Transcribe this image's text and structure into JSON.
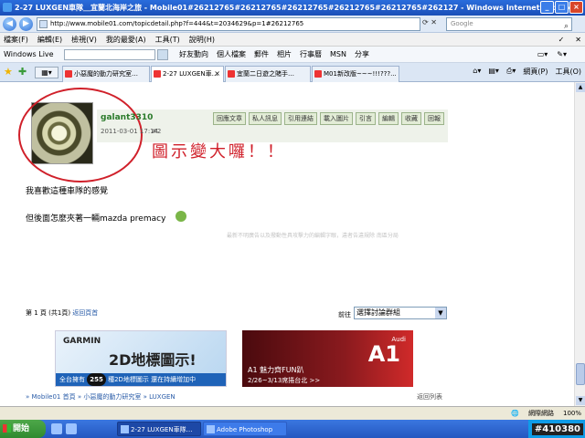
{
  "window": {
    "title": "2-27 LUXGEN車隊＿宜蘭北海岸之旅 - Mobile01#26212765#26212765#26212765#26212765#26212765#262127 - Windows Internet Explorer",
    "controls": [
      "_",
      "□",
      "×"
    ]
  },
  "address_bar": {
    "url": "http://www.mobile01.com/topicdetail.php?f=444&t=2034629&p=1#26212765",
    "search_placeholder": "Google"
  },
  "menu": {
    "items": [
      "檔案(F)",
      "編輯(E)",
      "檢視(V)",
      "我的最愛(A)",
      "工具(T)",
      "說明(H)"
    ],
    "right_items": [
      "✓",
      "✕"
    ]
  },
  "links_bar": {
    "windows_live": "Windows Live",
    "quick_links": [
      "好友動向",
      "個人檔案",
      "郵件",
      "相片",
      "行事曆",
      "MSN",
      "分享"
    ]
  },
  "tabs": [
    {
      "label": "小惡魔的動力研究室…"
    },
    {
      "label": "2-27 LUXGEN車…",
      "active": true
    },
    {
      "label": "宜蘭二日遊之賭手…"
    },
    {
      "label": "M01新改版~~~!!!???..."
    }
  ],
  "toolbar": {
    "page_label": "網頁(P)",
    "tools_label": "工具(O)"
  },
  "post": {
    "username": "galant3310",
    "date": "2011-03-01 17:14",
    "post_number": "#2",
    "actions": [
      "回應文章",
      "私人訊息",
      "引用連結",
      "載入圖片",
      "引言",
      "編輯",
      "收藏",
      "回報"
    ],
    "annotation": "圖示變大囉！！",
    "message_line1": "我喜歡這種車隊的感覺",
    "message_line2": "但後面怎麼夾著一輛mazda premacy",
    "disclaimer": "最新不明廣告以及撥動性具攻擊力的編輯字眼，違者告違規除 南區分局"
  },
  "pagination": {
    "text": "第 1 頁 (共1頁)",
    "back_link": "返回頁首",
    "goto_label": "前往",
    "goto_value": "選擇討論群組"
  },
  "ads": {
    "garmin": {
      "brand": "GARMIN",
      "headline": "2D地標圖示!",
      "strip_prefix": "全台擁有",
      "strip_number": "255",
      "strip_suffix": "種2D地標圖示 還在持續增加中"
    },
    "audi": {
      "rings": "Audi",
      "model": "A1",
      "line1": "A1 魅力齊FUN趴",
      "line2": "2/26~3/13席捲台北 >>"
    }
  },
  "breadcrumb": {
    "items": [
      "» Mobile01 首頁",
      "» 小惡魔的動力研究室",
      "» LUXGEN"
    ],
    "back_to_list": "返回列表"
  },
  "statusbar": {
    "left": "",
    "zone": "網際網路",
    "zoom": "100%"
  },
  "taskbar": {
    "start": "開始",
    "tasks": [
      {
        "label": "2-27 LUXGEN車隊…",
        "active": true
      },
      {
        "label": "Adobe Photoshop",
        "active": false
      }
    ],
    "tag": "#410380"
  },
  "colors": {
    "titlebar": "#1a4fb8",
    "annotation_red": "#d0202a",
    "username_green": "#2a7a2a",
    "audi_red": "#8a1a1e",
    "garmin_blue": "#1f63b8"
  }
}
